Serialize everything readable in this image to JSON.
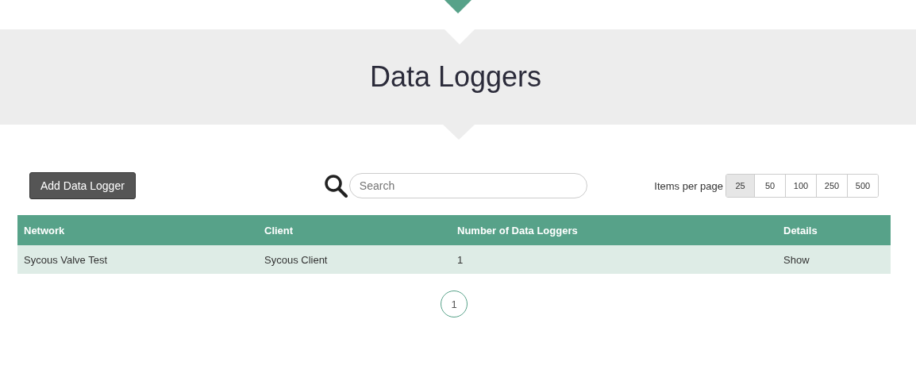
{
  "page_title": "Data Loggers",
  "add_button": "Add Data Logger",
  "search": {
    "placeholder": "Search"
  },
  "items_per_page": {
    "label": "Items per page",
    "options": [
      {
        "label": "25",
        "selected": true
      },
      {
        "label": "50",
        "selected": false
      },
      {
        "label": "100",
        "selected": false
      },
      {
        "label": "250",
        "selected": false
      },
      {
        "label": "500",
        "selected": false
      }
    ]
  },
  "table": {
    "columns": [
      "Network",
      "Client",
      "Number of Data Loggers",
      "Details"
    ],
    "rows": [
      {
        "network": "Sycous Valve Test",
        "client": "Sycous Client",
        "count": "1",
        "details": "Show"
      }
    ]
  },
  "pagination": [
    {
      "label": "1",
      "selected": true
    }
  ]
}
